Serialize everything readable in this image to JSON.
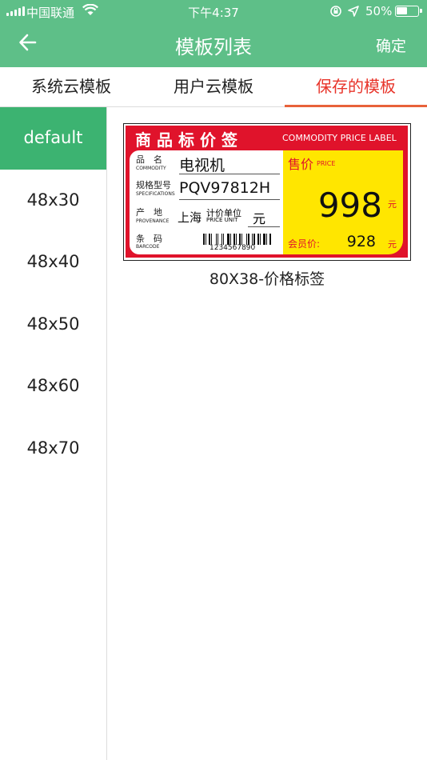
{
  "status_bar": {
    "carrier": "中国联通",
    "time": "下午4:37",
    "battery": "50%",
    "battery_level": 0.5
  },
  "navbar": {
    "title": "模板列表",
    "confirm_label": "确定",
    "back_icon": "arrow-left-icon"
  },
  "tabs": [
    {
      "label": "系统云模板",
      "active": false
    },
    {
      "label": "用户云模板",
      "active": false
    },
    {
      "label": "保存的模板",
      "active": true
    }
  ],
  "sidebar": {
    "items": [
      {
        "label": "default",
        "active": true
      },
      {
        "label": "48x30",
        "active": false
      },
      {
        "label": "48x40",
        "active": false
      },
      {
        "label": "48x50",
        "active": false
      },
      {
        "label": "48x60",
        "active": false
      },
      {
        "label": "48x70",
        "active": false
      }
    ]
  },
  "templates": [
    {
      "caption": "80X38-价格标签",
      "label": {
        "title_cn": "商品标价签",
        "title_en": "COMMODITY PRICE LABEL",
        "name_key": "品　名",
        "name_key_en": "COMMODITY",
        "name_value": "电视机",
        "spec_key": "规格型号",
        "spec_key_en": "SPECIFICATIONS",
        "spec_value": "PQV97812H",
        "origin_key": "产　地",
        "origin_key_en": "PROVENANCE",
        "origin_value": "上海",
        "unit_key": "计价单位",
        "unit_key_en": "PRICE UNIT",
        "unit_value": "元",
        "barcode_key": "条　码",
        "barcode_key_en": "BARCODE",
        "barcode_number": "1234567890",
        "price_label": "售价",
        "price_label_en": "PRICE",
        "price": "998",
        "price_unit": "元",
        "member_label": "会员价:",
        "member_price": "928",
        "member_unit": "元"
      }
    }
  ],
  "colors": {
    "header_green": "#5ebf88",
    "sidebar_active_green": "#3cb371",
    "tab_active_red": "#e8342a",
    "label_red": "#e0132b",
    "label_yellow": "#ffe600"
  }
}
